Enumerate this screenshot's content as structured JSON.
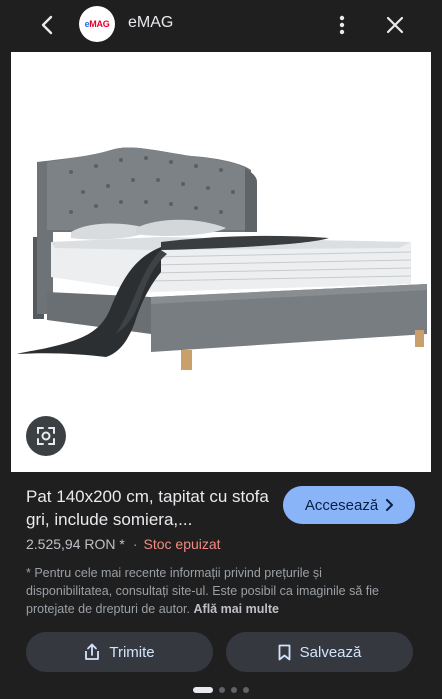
{
  "header": {
    "site_name": "eMAG",
    "logo_text_e": "e",
    "logo_text_rest": "MAG"
  },
  "product": {
    "title": "Pat 140x200 cm, tapitat cu stofa gri, include somiera,...",
    "price": "2.525,94 RON *",
    "separator": "·",
    "stock_status": "Stoc epuizat",
    "visit_label": "Accesează"
  },
  "disclaimer": {
    "text": "* Pentru cele mai recente informații privind prețurile și disponibilitatea, consultați site-ul. Este posibil ca imaginile să fie protejate de drepturi de autor.",
    "link": "Află mai multe"
  },
  "actions": {
    "share_label": "Trimite",
    "save_label": "Salvează"
  },
  "carousel": {
    "total": 4,
    "active": 0
  },
  "colors": {
    "background": "#1f1f1f",
    "accent_button": "#8ab4f8",
    "stock_out": "#f28b82",
    "action_button": "#35393f"
  },
  "icons": [
    "back-arrow-icon",
    "more-vert-icon",
    "close-icon",
    "lens-icon",
    "share-icon",
    "bookmark-icon",
    "chevron-right-icon"
  ]
}
